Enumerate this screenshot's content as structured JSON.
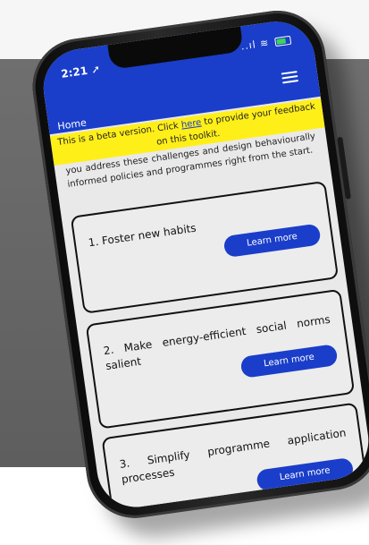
{
  "status_bar": {
    "time": "2:21",
    "signal": "..ıl",
    "wifi": "≋"
  },
  "nav": {
    "home": "Home"
  },
  "beta_banner": {
    "prefix": "This is a beta version. Click ",
    "link": "here",
    "suffix": " to provide your feedback on this toolkit."
  },
  "intro": "you address these challenges and design behaviourally informed policies and programmes right from the start.",
  "cards": [
    {
      "title": "1. Foster new habits",
      "button": "Learn more"
    },
    {
      "title": "2. Make energy-efficient social norms salient",
      "button": "Learn more"
    },
    {
      "title": "3. Simplify programme application processes",
      "button": "Learn more"
    }
  ],
  "colors": {
    "header_blue": "#1a3ec9",
    "banner_yellow": "#ffef19"
  },
  "icons": [
    "location-arrow-icon",
    "signal-icon",
    "wifi-icon",
    "battery-icon",
    "hamburger-menu-icon"
  ]
}
